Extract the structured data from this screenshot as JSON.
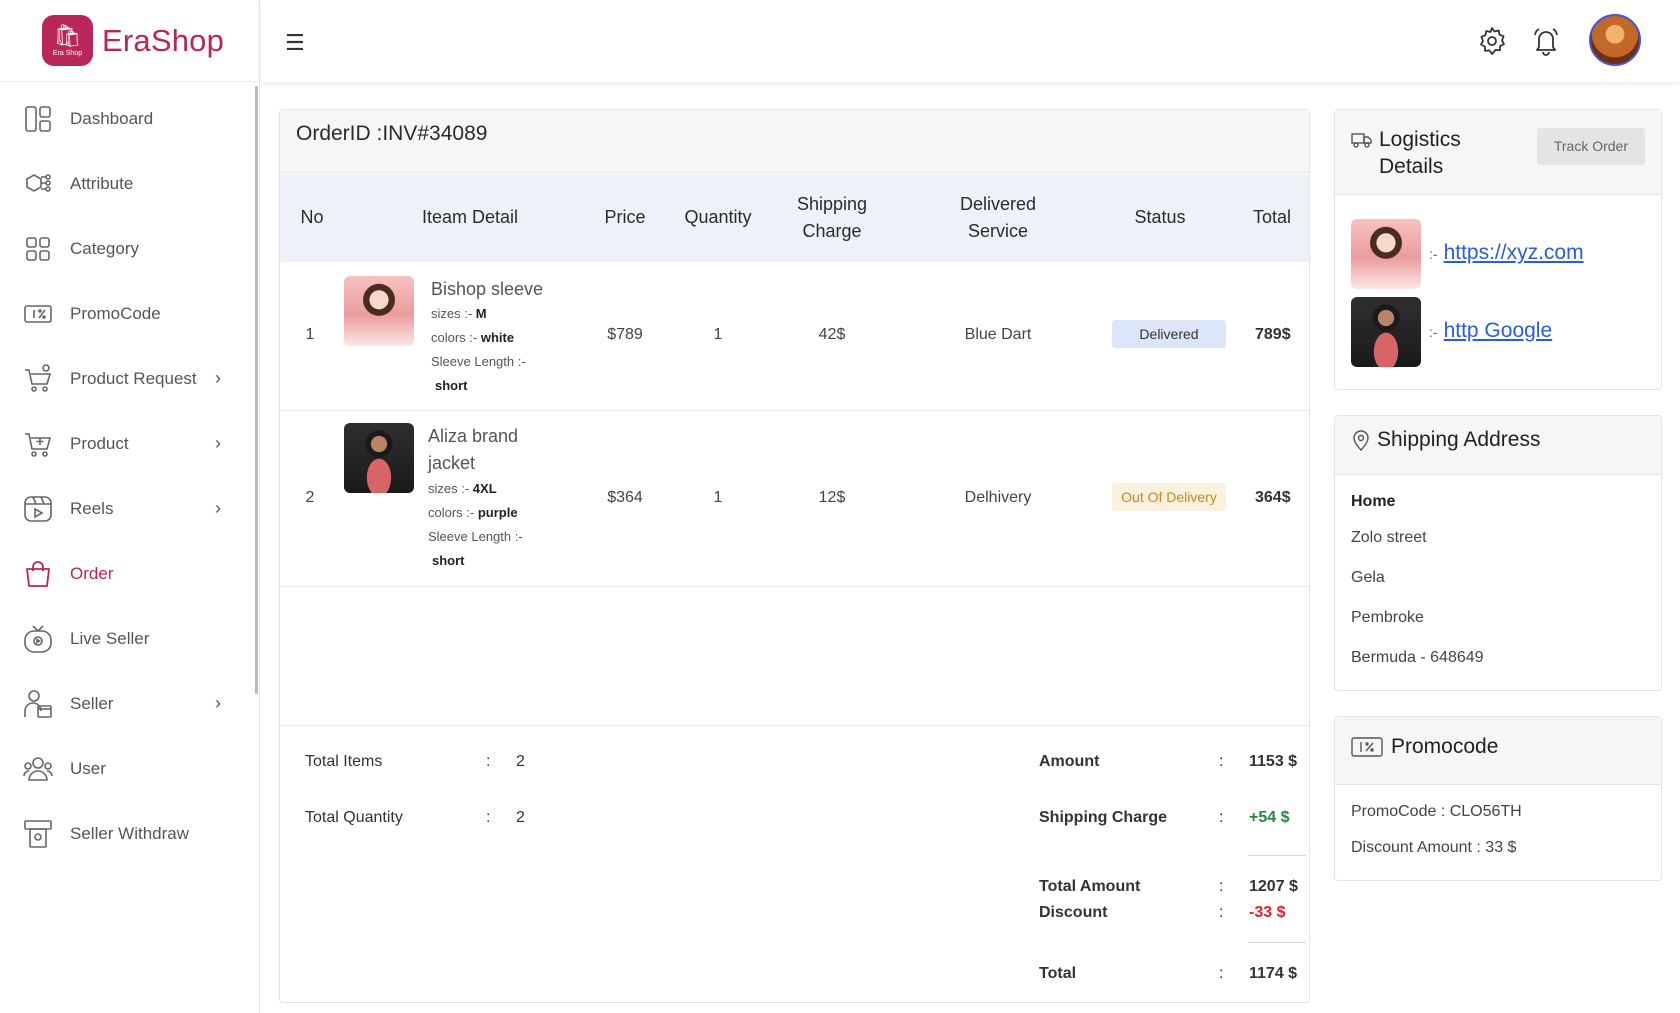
{
  "brand": {
    "name": "EraShop",
    "badge_text": "Era Shop",
    "color": "#b8265a"
  },
  "sidebar": {
    "items": [
      {
        "label": "Dashboard",
        "icon": "dashboard-icon"
      },
      {
        "label": "Attribute",
        "icon": "attribute-icon"
      },
      {
        "label": "Category",
        "icon": "category-icon"
      },
      {
        "label": "PromoCode",
        "icon": "promocode-icon"
      },
      {
        "label": "Product Request",
        "icon": "cart-request-icon",
        "has_chevron": true
      },
      {
        "label": "Product",
        "icon": "cart-icon",
        "has_chevron": true
      },
      {
        "label": "Reels",
        "icon": "reels-icon",
        "has_chevron": true
      },
      {
        "label": "Order",
        "icon": "order-bag-icon",
        "active": true
      },
      {
        "label": "Live Seller",
        "icon": "live-tv-icon"
      },
      {
        "label": "Seller",
        "icon": "seller-icon",
        "has_chevron": true
      },
      {
        "label": "User",
        "icon": "users-icon"
      },
      {
        "label": "Seller Withdraw",
        "icon": "withdraw-icon"
      }
    ]
  },
  "topbar": {
    "menu_icon": "hamburger-icon",
    "settings_icon": "gear-icon",
    "notification_icon": "bell-icon"
  },
  "order": {
    "title": "OrderID :INV#34089",
    "columns": [
      "No",
      "Iteam Detail",
      "Price",
      "Quantity",
      "Shipping Charge",
      "Delivered Service",
      "Status",
      "Total"
    ],
    "rows": [
      {
        "no": "1",
        "name": "Bishop sleeve",
        "sizes_label": "sizes :-",
        "sizes": "M",
        "colors_label": "colors :-",
        "colors": "white",
        "sleeve_label": "Sleeve Length :-",
        "sleeve": "short",
        "price": "$789",
        "quantity": "1",
        "shipping": "42$",
        "service": "Blue Dart",
        "status": "Delivered",
        "total": "789$"
      },
      {
        "no": "2",
        "name": "Aliza brand jacket",
        "sizes_label": "sizes :-",
        "sizes": "4XL",
        "colors_label": "colors :-",
        "colors": "purple",
        "sleeve_label": "Sleeve Length :-",
        "sleeve": "short",
        "price": "$364",
        "quantity": "1",
        "shipping": "12$",
        "service": "Delhivery",
        "status": "Out Of Delivery",
        "total": "364$"
      }
    ],
    "summary": {
      "total_items_label": "Total Items",
      "total_items": "2",
      "total_quantity_label": "Total Quantity",
      "total_quantity": "2",
      "amount_label": "Amount",
      "amount": "1153 $",
      "shipping_label": "Shipping Charge",
      "shipping": "+54 $",
      "total_amount_label": "Total Amount",
      "total_amount": "1207 $",
      "discount_label": "Discount",
      "discount": "-33 $",
      "total_label": "Total",
      "total": "1174 $",
      "colon": ":"
    }
  },
  "logistics": {
    "title": "Logistics Details",
    "track_label": "Track Order",
    "separator": ":-",
    "links": [
      "https://xyz.com",
      "http Google"
    ]
  },
  "shipping_address": {
    "title": "Shipping Address",
    "type": "Home",
    "lines": [
      "Zolo street",
      "Gela",
      "Pembroke",
      "Bermuda - 648649"
    ]
  },
  "promocode": {
    "title": "Promocode",
    "code_line": "PromoCode : CLO56TH",
    "discount_line": "Discount Amount : 33 $"
  }
}
